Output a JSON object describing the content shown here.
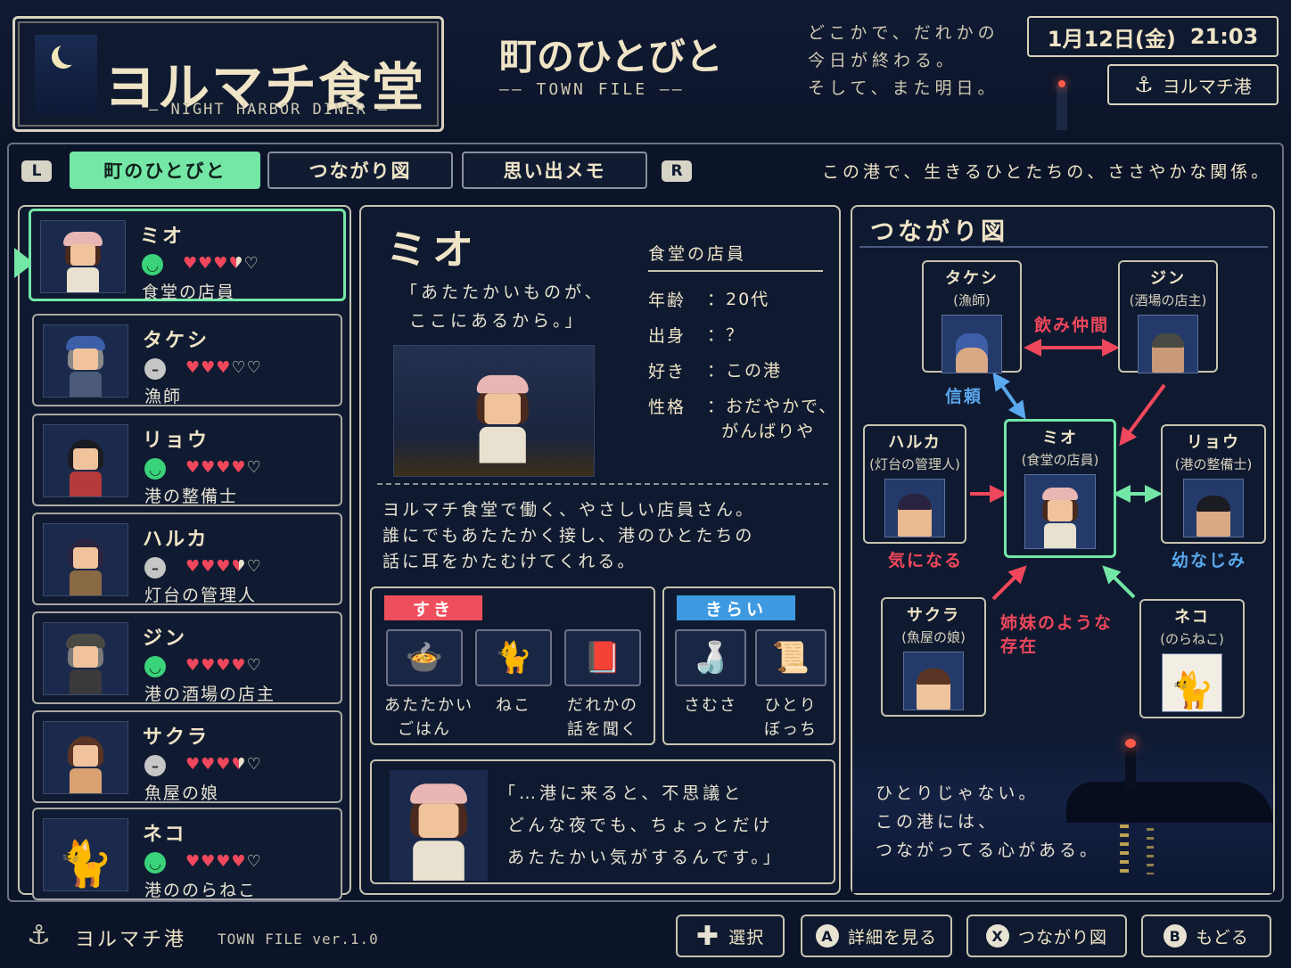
{
  "header": {
    "logo_title": "ヨルマチ食堂",
    "logo_sub": "— NIGHT HARBOR DINER —",
    "page_title": "町のひとびと",
    "page_sub": "—— TOWN FILE ——",
    "tagline": "どこかで、だれかの\n今日が終わる。\nそして、また明日。",
    "date": "1月12日(金)",
    "time": "21:03",
    "port": "ヨルマチ港"
  },
  "tabs": {
    "left_key": "L",
    "right_key": "R",
    "items": [
      {
        "label": "町のひとびと"
      },
      {
        "label": "つながり図"
      },
      {
        "label": "思い出メモ"
      }
    ],
    "caption": "この港で、生きるひとたちの、ささやかな関係。"
  },
  "characters": [
    {
      "name": "ミオ",
      "role": "食堂の店員",
      "mood": "happy",
      "hearts": 3.5,
      "hair": "#4a2a1e",
      "outfit": "#e9e1cf",
      "cap": "#e8b7b4"
    },
    {
      "name": "タケシ",
      "role": "漁師",
      "mood": "neutral",
      "hearts": 3,
      "hair": "#8a8a8a",
      "outfit": "#4a5a78",
      "cap": "#3c5fa8"
    },
    {
      "name": "リョウ",
      "role": "港の整備士",
      "mood": "happy",
      "hearts": 4,
      "hair": "#1b1b22",
      "outfit": "#b53a3a",
      "cap": ""
    },
    {
      "name": "ハルカ",
      "role": "灯台の管理人",
      "mood": "neutral",
      "hearts": 3.5,
      "hair": "#2a2440",
      "outfit": "#8a6a44",
      "cap": ""
    },
    {
      "name": "ジン",
      "role": "港の酒場の店主",
      "mood": "happy",
      "hearts": 4,
      "hair": "#7a7a7a",
      "outfit": "#3a3a3a",
      "cap": "#4a4a44"
    },
    {
      "name": "サクラ",
      "role": "魚屋の娘",
      "mood": "neutral",
      "hearts": 3.5,
      "hair": "#5a3424",
      "outfit": "#d9a070",
      "cap": ""
    },
    {
      "name": "ネコ",
      "role": "港ののらねこ",
      "mood": "happy",
      "hearts": 4,
      "hair": "",
      "outfit": "",
      "cap": ""
    }
  ],
  "detail": {
    "name": "ミオ",
    "quote": "「あたたかいものが、\n ここにあるから。」",
    "role_heading": "食堂の店員",
    "stats": [
      {
        "key": "年齢",
        "value": "：20代"
      },
      {
        "key": "出身",
        "value": "：？"
      },
      {
        "key": "好き",
        "value": "：この港"
      },
      {
        "key": "性格",
        "value": "：おだやかで、\n  がんばりや"
      }
    ],
    "description": "ヨルマチ食堂で働く、やさしい店員さん。\n誰にでもあたたかく接し、港のひとたちの\n話に耳をかたむけてくれる。",
    "likes_label": "すき",
    "likes": [
      {
        "label": "あたたかい\nごはん",
        "icon": "bowl-icon",
        "glyph": "🍲"
      },
      {
        "label": "ねこ",
        "icon": "cat-icon",
        "glyph": "🐈"
      },
      {
        "label": "だれかの\n話を聞く",
        "icon": "book-icon",
        "glyph": "📕"
      }
    ],
    "dislikes_label": "きらい",
    "dislikes": [
      {
        "label": "さむさ",
        "icon": "bottle-icon",
        "glyph": "🍶"
      },
      {
        "label": "ひとり\nぼっち",
        "icon": "scroll-icon",
        "glyph": "📜"
      }
    ],
    "dialog": "「…港に来ると、不思議と\n どんな夜でも、ちょっとだけ\n あたたかい気がするんです。」"
  },
  "map": {
    "title": "つながり図",
    "nodes": {
      "takeshi": {
        "name": "タケシ",
        "role": "(漁師)"
      },
      "jin": {
        "name": "ジン",
        "role": "(酒場の店主)"
      },
      "haruka": {
        "name": "ハルカ",
        "role": "(灯台の管理人)"
      },
      "mio": {
        "name": "ミオ",
        "role": "(食堂の店員)"
      },
      "ryo": {
        "name": "リョウ",
        "role": "(港の整備士)"
      },
      "sakura": {
        "name": "サクラ",
        "role": "(魚屋の娘)"
      },
      "neko": {
        "name": "ネコ",
        "role": "(のらねこ)"
      }
    },
    "relations": {
      "drinking": "飲み仲間",
      "trust": "信頼",
      "curious": "気になる",
      "childhood": "幼なじみ",
      "sisters": "姉妹のような\n存在"
    },
    "colors": {
      "red": "#f0475c",
      "blue": "#5aa8ee",
      "green": "#74e7a7"
    },
    "quote": "ひとりじゃない。\nこの港には、\nつながってる心がある。"
  },
  "footer": {
    "port": "ヨルマチ港",
    "version": "TOWN FILE ver.1.0",
    "buttons": [
      {
        "glyph": "✚",
        "label": "選択"
      },
      {
        "glyph": "A",
        "label": "詳細を見る"
      },
      {
        "glyph": "X",
        "label": "つながり図"
      },
      {
        "glyph": "B",
        "label": "もどる"
      }
    ]
  }
}
